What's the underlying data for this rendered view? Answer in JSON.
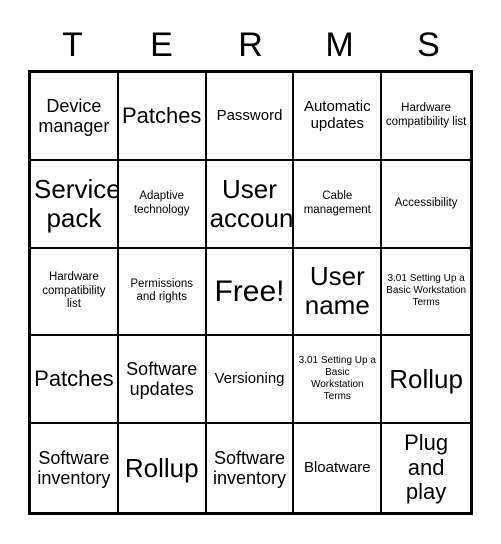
{
  "header": {
    "letters": [
      "T",
      "E",
      "R",
      "M",
      "S"
    ]
  },
  "card": {
    "title_text": "3.01 Setting Up a Basic Workstation Terms",
    "free_label": "Free!",
    "cells": [
      {
        "text": "Device manager",
        "size": "s-lg"
      },
      {
        "text": "Patches",
        "size": "s-xl"
      },
      {
        "text": "Password",
        "size": "s-md"
      },
      {
        "text": "Automatic updates",
        "size": "s-md"
      },
      {
        "text": "Hardware compatibility list",
        "size": "s-sm"
      },
      {
        "text": "Service pack",
        "size": "s-xxl"
      },
      {
        "text": "Adaptive technology",
        "size": "s-sm"
      },
      {
        "text": "User account",
        "size": "s-xxl"
      },
      {
        "text": "Cable management",
        "size": "s-sm"
      },
      {
        "text": "Accessibility",
        "size": "s-sm"
      },
      {
        "text": "Hardware compatibility list",
        "size": "s-sm"
      },
      {
        "text": "Permissions and rights",
        "size": "s-sm"
      },
      {
        "text": "Free!",
        "size": "s-free"
      },
      {
        "text": "User name",
        "size": "s-xxl"
      },
      {
        "text": "3.01 Setting Up a Basic Workstation Terms",
        "size": "s-xs"
      },
      {
        "text": "Patches",
        "size": "s-xl"
      },
      {
        "text": "Software updates",
        "size": "s-lg"
      },
      {
        "text": "Versioning",
        "size": "s-md"
      },
      {
        "text": "3.01 Setting Up a Basic Workstation Terms",
        "size": "s-xs"
      },
      {
        "text": "Rollup",
        "size": "s-xxl"
      },
      {
        "text": "Software inventory",
        "size": "s-lg"
      },
      {
        "text": "Rollup",
        "size": "s-xxl"
      },
      {
        "text": "Software inventory",
        "size": "s-lg"
      },
      {
        "text": "Bloatware",
        "size": "s-md"
      },
      {
        "text": "Plug and play",
        "size": "s-xl"
      }
    ]
  },
  "colors": {
    "ink": "#000000",
    "paper": "#ffffff"
  }
}
